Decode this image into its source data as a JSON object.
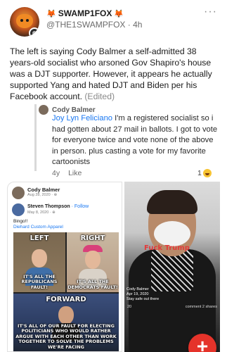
{
  "post": {
    "display_name": "SWAMP1FOX",
    "handle": "@THE1SWAMPFOX",
    "time_sep": "·",
    "age": "4h",
    "menu": "···",
    "fox_emoji": "🦊",
    "body": "The left is saying Cody Balmer a self-admitted 38 years-old socialist who arsoned Gov Shapiro's house was a DJT supporter. However, it appears he actually supported Yang and hated DJT and Biden per his Facebook account.",
    "edited_label": "(Edited)"
  },
  "comment": {
    "author": "Cody Balmer",
    "mention": "Joy Lyn Feliciano",
    "text": " I'm a registered socialist so i had gotten about 27 mail in ballots. I got to vote for everyone twice and vote none of the above in person. plus casting a vote for my favorite cartoonists",
    "age": "4y",
    "like_label": "Like",
    "reaction_count": "1"
  },
  "left_screenshot": {
    "author": "Cody Balmer",
    "date": "Aug 28, 2020 · ⊕",
    "shared_author": "Steven Thompson",
    "follow": " · Follow",
    "shared_date": "May 8, 2020 · ⊕",
    "text": "Bingo!!",
    "link": "Diehard Custom Apparel",
    "meme": {
      "left_label": "LEFT",
      "left_caption": "IT'S ALL THE REPUBLICANS FAULT!",
      "right_label": "RIGHT",
      "right_caption": "IT'S ALL THE DEMOCRATS FAULT!",
      "forward_label": "FORWARD",
      "forward_caption": "IT'S ALL OF OUR FAULT FOR ELECTING POLITICIANS WHO WOULD RATHER ARGUE WITH EACH OTHER THAN WORK TOGETHER TO SOLVE THE PROBLEMS WE'RE FACING"
    }
  },
  "right_screenshot": {
    "overlay_text": "Fuck Trump",
    "info_name": "Cody Balmer",
    "info_date": "Apr 19, 2020",
    "info_sub": "Stay safe out there",
    "reactions": "20",
    "comments": "comment  2 shares"
  },
  "fab": {
    "label": "+"
  },
  "colors": {
    "accent": "#e5332a",
    "link": "#1877f2"
  }
}
